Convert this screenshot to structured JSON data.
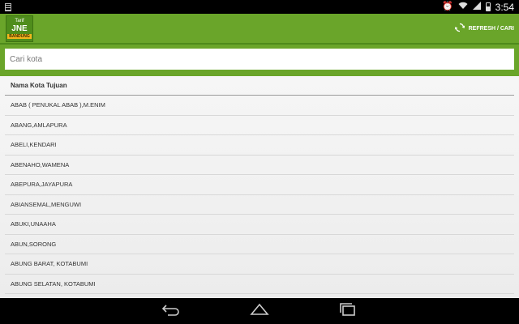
{
  "statusbar": {
    "time": "3:54",
    "icons": [
      "alarm-icon",
      "wifi-icon",
      "signal-icon",
      "battery-icon"
    ]
  },
  "app": {
    "logo": {
      "line1": "Tarif",
      "line2": "JNE",
      "line3": "BANDUNG"
    },
    "refresh_label": "REFRESH / CARI"
  },
  "search": {
    "placeholder": "Cari kota",
    "value": ""
  },
  "list": {
    "header": "Nama Kota Tujuan",
    "items": [
      "ABAB ( PENUKAL ABAB ),M.ENIM",
      "ABANG,AMLAPURA",
      "ABELI,KENDARI",
      "ABENAHO,WAMENA",
      "ABEPURA,JAYAPURA",
      "ABIANSEMAL,MENGUWI",
      "ABUKI,UNAAHA",
      "ABUN,SORONG",
      "ABUNG BARAT, KOTABUMI",
      "ABUNG SELATAN, KOTABUMI"
    ]
  },
  "colors": {
    "appbar": "#6aa52a",
    "accent_badge": "#f3b51d"
  },
  "navbar": {
    "icons": [
      "back-icon",
      "home-icon",
      "recents-icon"
    ]
  }
}
